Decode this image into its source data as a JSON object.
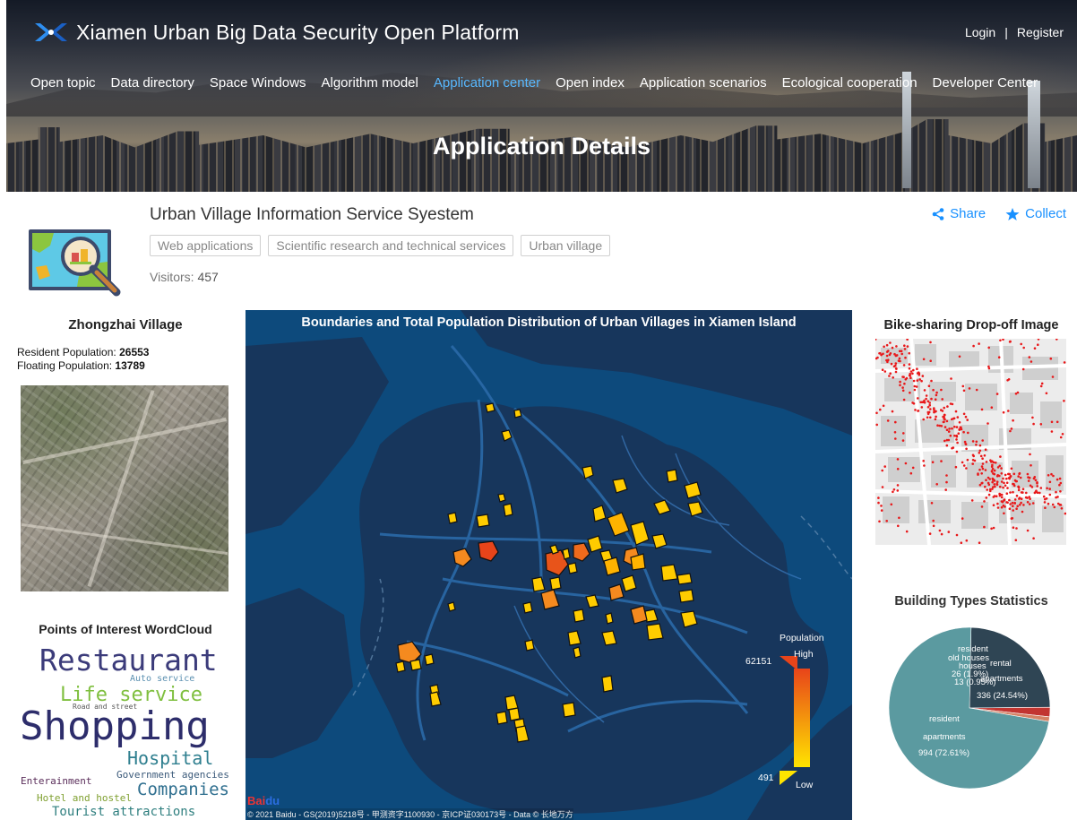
{
  "header": {
    "brand": "Xiamen Urban Big Data Security Open Platform",
    "login": "Login",
    "separator": "|",
    "register": "Register",
    "nav": [
      {
        "label": "Open topic",
        "active": false
      },
      {
        "label": "Data directory",
        "active": false
      },
      {
        "label": "Space Windows",
        "active": false
      },
      {
        "label": "Algorithm model",
        "active": false
      },
      {
        "label": "Application center",
        "active": true
      },
      {
        "label": "Open index",
        "active": false
      },
      {
        "label": "Application scenarios",
        "active": false
      },
      {
        "label": "Ecological cooperation",
        "active": false
      },
      {
        "label": "Developer Center",
        "active": false
      }
    ],
    "page_title": "Application Details",
    "active_color": "#58b8ff"
  },
  "app": {
    "title": "Urban Village Information Service Syestem",
    "tags": [
      "Web applications",
      "Scientific research and technical services",
      "Urban village"
    ],
    "visitors_label": "Visitors:",
    "visitors_value": "457",
    "share": "Share",
    "collect": "Collect",
    "accent": "#1890ff"
  },
  "village": {
    "title": "Zhongzhai Village",
    "resident_label": "Resident Population:",
    "resident_value": "26553",
    "floating_label": "Floating Population:",
    "floating_value": "13789"
  },
  "wordcloud": {
    "title": "Points of Interest WordCloud",
    "words": [
      {
        "text": "Restaurant",
        "color": "#3b3b7a"
      },
      {
        "text": "Auto service",
        "color": "#5a8fb0"
      },
      {
        "text": "Life service",
        "color": "#7fbf3f"
      },
      {
        "text": "Road and street",
        "color": "#555555"
      },
      {
        "text": "Shopping",
        "color": "#2d2d6b"
      },
      {
        "text": "Hospital",
        "color": "#2f7f8f"
      },
      {
        "text": "Enterainment",
        "color": "#5a2d5a"
      },
      {
        "text": "Government agencies",
        "color": "#3b5a7a"
      },
      {
        "text": "Companies",
        "color": "#2f6f8f"
      },
      {
        "text": "Hotel and hostel",
        "color": "#7fa030"
      },
      {
        "text": "Tourist attractions",
        "color": "#2f7f7f"
      }
    ]
  },
  "map": {
    "title": "Boundaries and Total Population Distribution of Urban Villages in Xiamen Island",
    "legend_title": "Population",
    "legend_high": "High",
    "legend_low": "Low",
    "legend_max": "62151",
    "legend_min": "491",
    "baidu_logo_a": "Bai",
    "baidu_logo_b": "du",
    "copyright": "© 2021 Baidu - GS(2019)5218号 - 甲测资字1100930 - 京ICP证030173号 - Data © 长地万方",
    "water_color": "#0d4a7c",
    "land_color": "#17365c",
    "high_color": "#e8441a",
    "low_color": "#ffe400"
  },
  "bike": {
    "title": "Bike-sharing Drop-off Image",
    "dot_color": "#e8181a"
  },
  "building": {
    "title": "Building Types Statistics"
  },
  "chart_data": {
    "type": "pie",
    "title": "Building Types Statistics",
    "slices": [
      {
        "name": "resident apartments",
        "value": 994,
        "percent": "72.61%",
        "color": "#5b9aa0"
      },
      {
        "name": "rental apartments",
        "value": 336,
        "percent": "24.54%",
        "color": "#2f4554"
      },
      {
        "name": "resident old houses",
        "value": 26,
        "percent": "1.9%",
        "color": "#c23531"
      },
      {
        "name": "houses",
        "value": 13,
        "percent": "0.95%",
        "color": "#d48265"
      }
    ],
    "labels": {
      "resident_a": "resident",
      "resident_b": "apartments",
      "resident_c": "994 (72.61%)",
      "rental_a": "rental",
      "rental_b": "apartments",
      "rental_c": "336 (24.54%)",
      "old_a": "resident",
      "old_b": "old houses",
      "old_c": "26 (1.9%)",
      "houses_a": "houses",
      "houses_b": "13 (0.95%)"
    }
  }
}
